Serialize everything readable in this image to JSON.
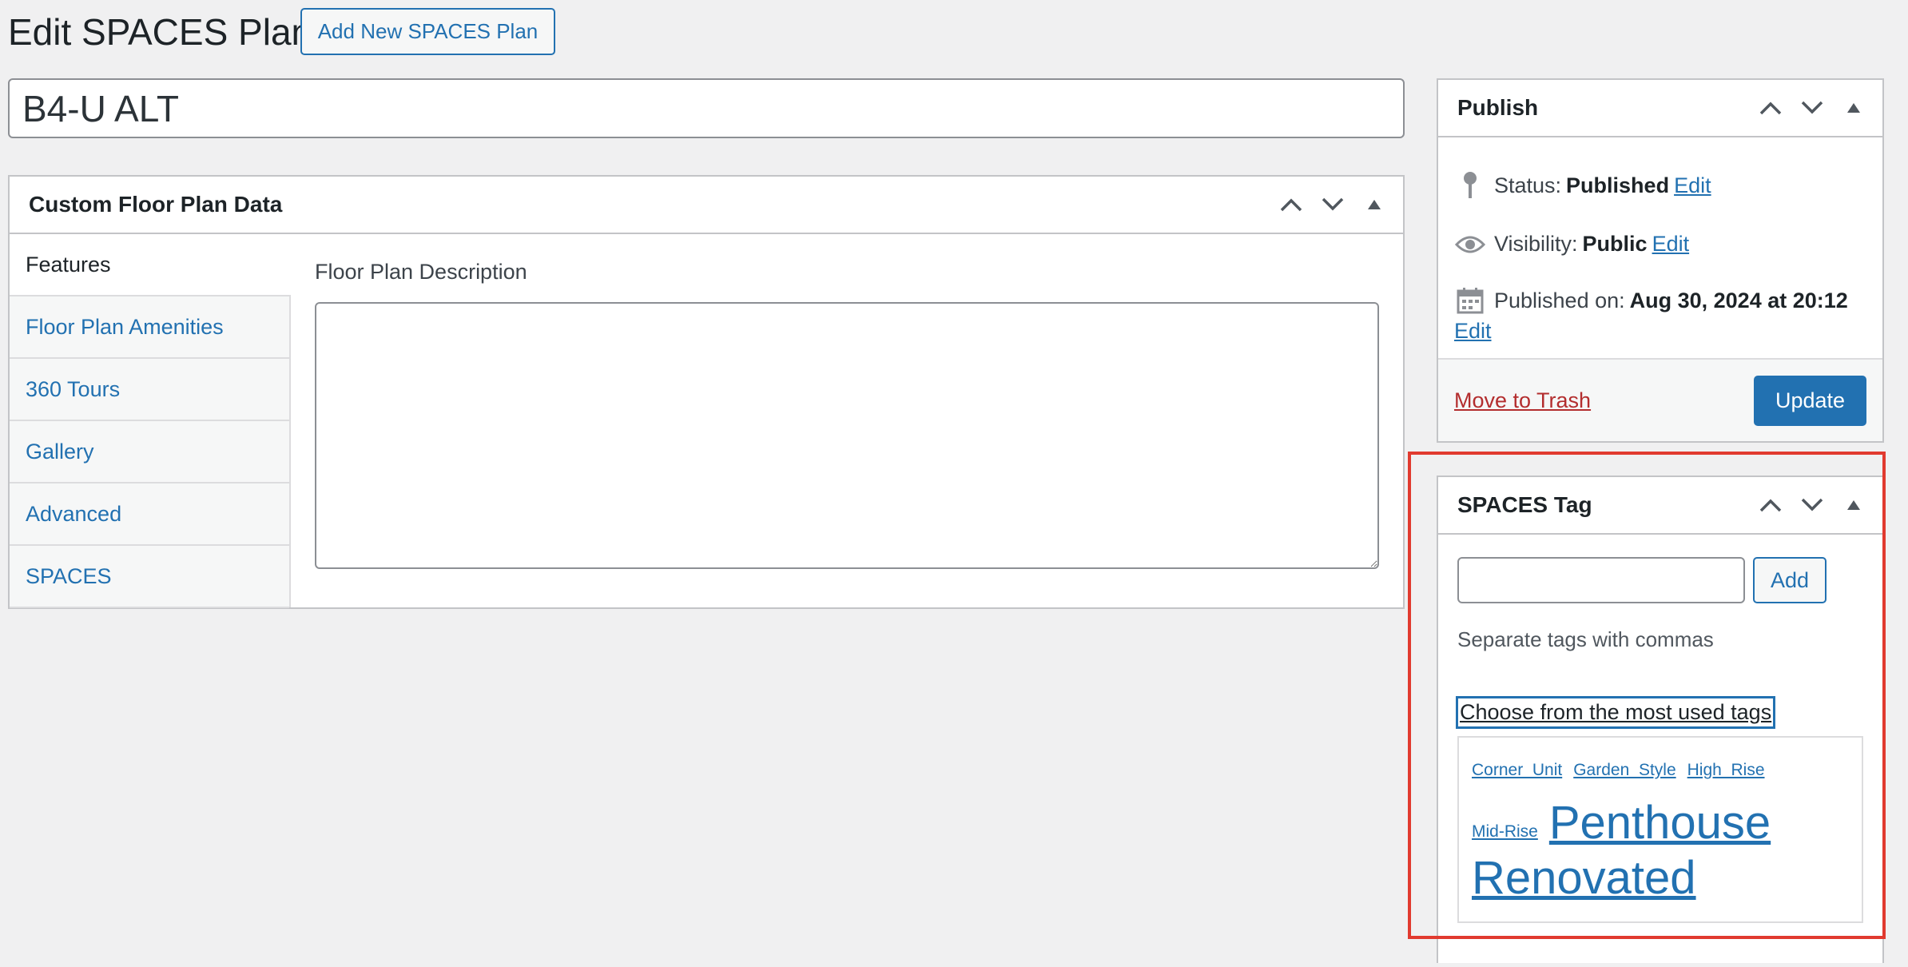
{
  "header": {
    "title": "Edit SPACES Plan",
    "add_new_label": "Add New SPACES Plan"
  },
  "post_title": {
    "value": "B4-U ALT"
  },
  "floor_plan_box": {
    "title": "Custom Floor Plan Data",
    "tabs": [
      {
        "label": "Features",
        "active": true
      },
      {
        "label": "Floor Plan Amenities"
      },
      {
        "label": "360 Tours"
      },
      {
        "label": "Gallery"
      },
      {
        "label": "Advanced"
      },
      {
        "label": "SPACES"
      }
    ],
    "description_label": "Floor Plan Description",
    "description_value": ""
  },
  "publish_box": {
    "title": "Publish",
    "status_label": "Status:",
    "status_value": "Published",
    "visibility_label": "Visibility:",
    "visibility_value": "Public",
    "published_on_label": "Published on:",
    "published_on_value": "Aug 30, 2024 at 20:12",
    "edit_label": "Edit",
    "trash_label": "Move to Trash",
    "update_label": "Update"
  },
  "tags_box": {
    "title": "SPACES Tag",
    "input_value": "",
    "add_label": "Add",
    "hint": "Separate tags with commas",
    "choose_label": "Choose from the most used tags",
    "cloud": [
      {
        "label": "Corner_Unit",
        "size": "small"
      },
      {
        "label": "Garden_Style",
        "size": "small"
      },
      {
        "label": "High_Rise",
        "size": "small"
      },
      {
        "label": "Mid-Rise",
        "size": "small"
      },
      {
        "label": "Penthouse",
        "size": "large"
      },
      {
        "label": "Renovated",
        "size": "large"
      }
    ]
  },
  "colors": {
    "accent": "#2271b1",
    "danger": "#b32d2e",
    "highlight": "#e13a2f",
    "background": "#f0f0f1"
  },
  "icons": [
    "chevron-up-icon",
    "chevron-down-icon",
    "triangle-up-icon",
    "pin-icon",
    "eye-icon",
    "calendar-icon"
  ]
}
